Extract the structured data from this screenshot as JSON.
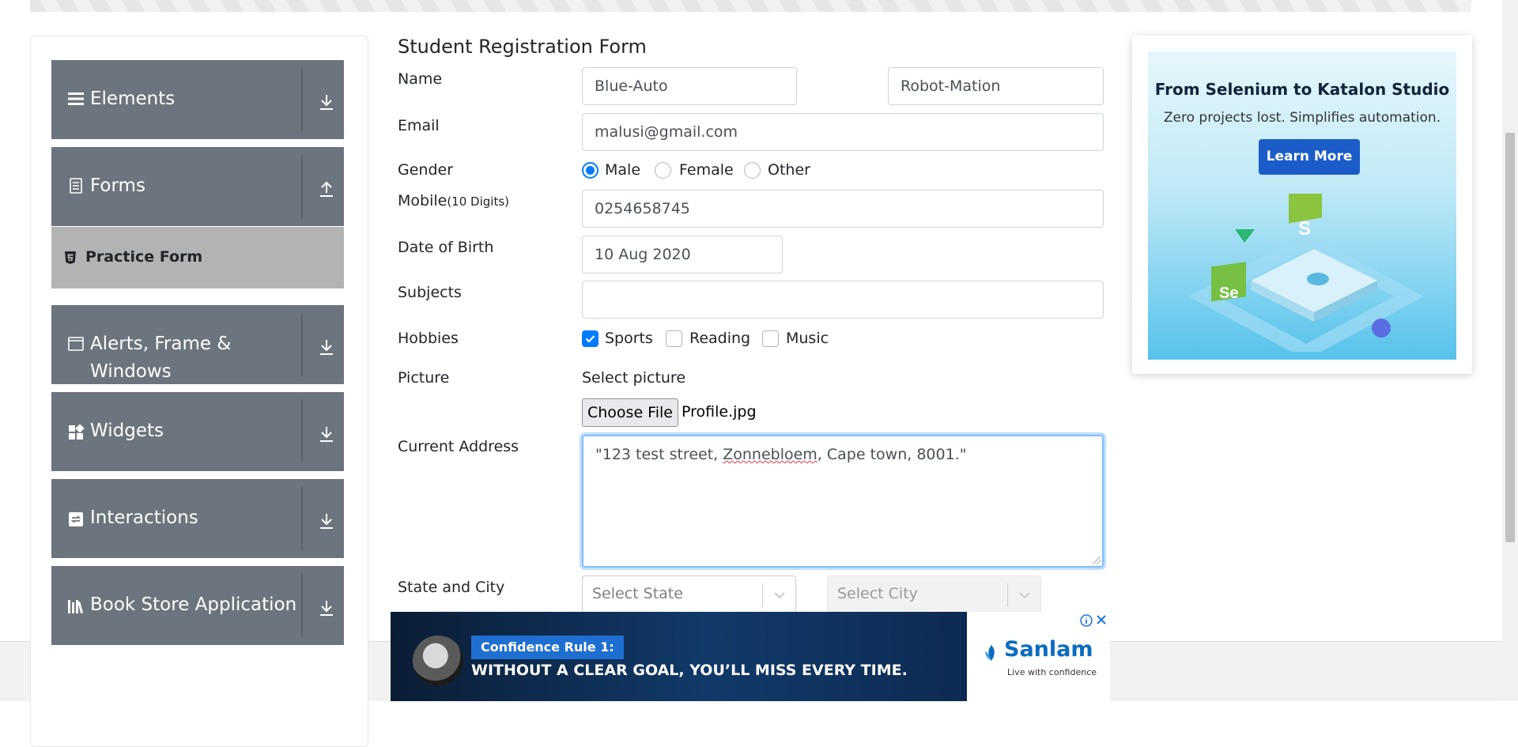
{
  "sidebar": {
    "groups": [
      {
        "label": "Elements",
        "icon": "list-icon",
        "arrow": "download-arrow-icon"
      },
      {
        "label": "Forms",
        "icon": "document-icon",
        "arrow": "upload-arrow-icon"
      },
      {
        "label": "Alerts, Frame &",
        "label_line2": "Windows",
        "icon": "window-icon",
        "arrow": "download-arrow-icon"
      },
      {
        "label": "Widgets",
        "icon": "widgets-icon",
        "arrow": "download-arrow-icon"
      },
      {
        "label": "Interactions",
        "icon": "interactions-icon",
        "arrow": "download-arrow-icon"
      },
      {
        "label": "Book Store Application",
        "icon": "books-icon",
        "arrow": "download-arrow-icon"
      }
    ],
    "active_item": {
      "label": "Practice Form",
      "icon": "html5-icon"
    }
  },
  "form": {
    "title": "Student Registration Form",
    "name_label": "Name",
    "first_name": "Blue-Auto",
    "last_name": "Robot-Mation",
    "email_label": "Email",
    "email": "malusi@gmail.com",
    "gender_label": "Gender",
    "gender_options": [
      "Male",
      "Female",
      "Other"
    ],
    "gender_selected": "Male",
    "mobile_label": "Mobile",
    "mobile_hint": "(10 Digits)",
    "mobile": "0254658745",
    "dob_label": "Date of Birth",
    "dob": "10 Aug 2020",
    "subjects_label": "Subjects",
    "subjects": "",
    "hobbies_label": "Hobbies",
    "hobbies": [
      "Sports",
      "Reading",
      "Music"
    ],
    "hobbies_checked": [
      "Sports"
    ],
    "picture_label": "Picture",
    "picture_prompt": "Select picture",
    "file_button": "Choose File",
    "file_name": "Profile.jpg",
    "address_label": "Current Address",
    "address_pre": "\"123 test street, ",
    "address_misspelled": "Zonnebloem",
    "address_post": ", Cape town, 8001.\"",
    "state_city_label": "State and City",
    "state_placeholder": "Select State",
    "city_placeholder": "Select City"
  },
  "ad_right": {
    "headline": "From Selenium to Katalon Studio",
    "subtext": "Zero projects lost. Simplifies automation.",
    "cta": "Learn More"
  },
  "ad_bottom": {
    "tag": "Confidence Rule 1:",
    "slogan": "WITHOUT A CLEAR GOAL, YOU’LL MISS EVERY TIME.",
    "brand": "Sanlam",
    "brand_tagline": "Live with confidence"
  },
  "colors": {
    "sidebar_bg": "#6c757d",
    "active_item_bg": "#b3b3b3",
    "accent": "#007bff",
    "ad_cta": "#1b5cc9",
    "brand_blue": "#0a6cc1"
  }
}
